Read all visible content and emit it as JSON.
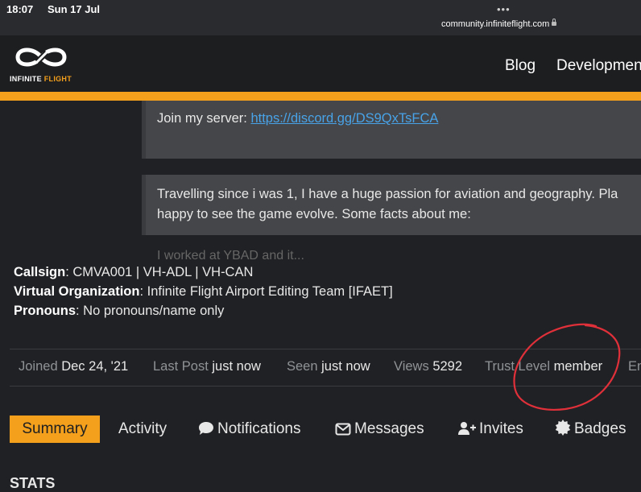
{
  "status_bar": {
    "time": "18:07",
    "date": "Sun 17 Jul",
    "dots": "•••",
    "url": "community.infiniteflight.com"
  },
  "header": {
    "logo_word1": "INFINITE",
    "logo_word2": "FLIGHT",
    "nav": [
      "Blog",
      "Development"
    ]
  },
  "bio": {
    "server_label": "Join my server: ",
    "server_link": "https://discord.gg/DS9QxTsFCA",
    "para_line1": "Travelling since i was 1, I have a huge passion for aviation and geography. Pla",
    "para_line2": "happy to see the game evolve. Some facts about me:",
    "faded_line": "I   worked at YBAD and it..."
  },
  "fields": [
    {
      "label": "Callsign",
      "value": ": CMVA001 | VH-ADL | VH-CAN"
    },
    {
      "label": "Virtual Organization",
      "value": ": Infinite Flight Airport Editing Team [IFAET]"
    },
    {
      "label": "Pronouns",
      "value": ": No pronouns/name only"
    }
  ],
  "stats": [
    {
      "label": "Joined",
      "value": "Dec 24, '21"
    },
    {
      "label": "Last Post",
      "value": "just now"
    },
    {
      "label": "Seen",
      "value": "just now"
    },
    {
      "label": "Views",
      "value": "5292"
    },
    {
      "label": "Trust Level",
      "value": "member"
    },
    {
      "label": "En",
      "value": ""
    }
  ],
  "tabs": [
    {
      "label": "Summary",
      "icon": ""
    },
    {
      "label": "Activity",
      "icon": ""
    },
    {
      "label": "Notifications",
      "icon": "comment-icon"
    },
    {
      "label": "Messages",
      "icon": "envelope-icon"
    },
    {
      "label": "Invites",
      "icon": "user-plus-icon"
    },
    {
      "label": "Badges",
      "icon": "badge-icon"
    }
  ],
  "section_heading": "STATS",
  "colors": {
    "accent": "#f4a01c",
    "background": "#202124",
    "link": "#48a3e8",
    "annotation": "#e0303a"
  }
}
